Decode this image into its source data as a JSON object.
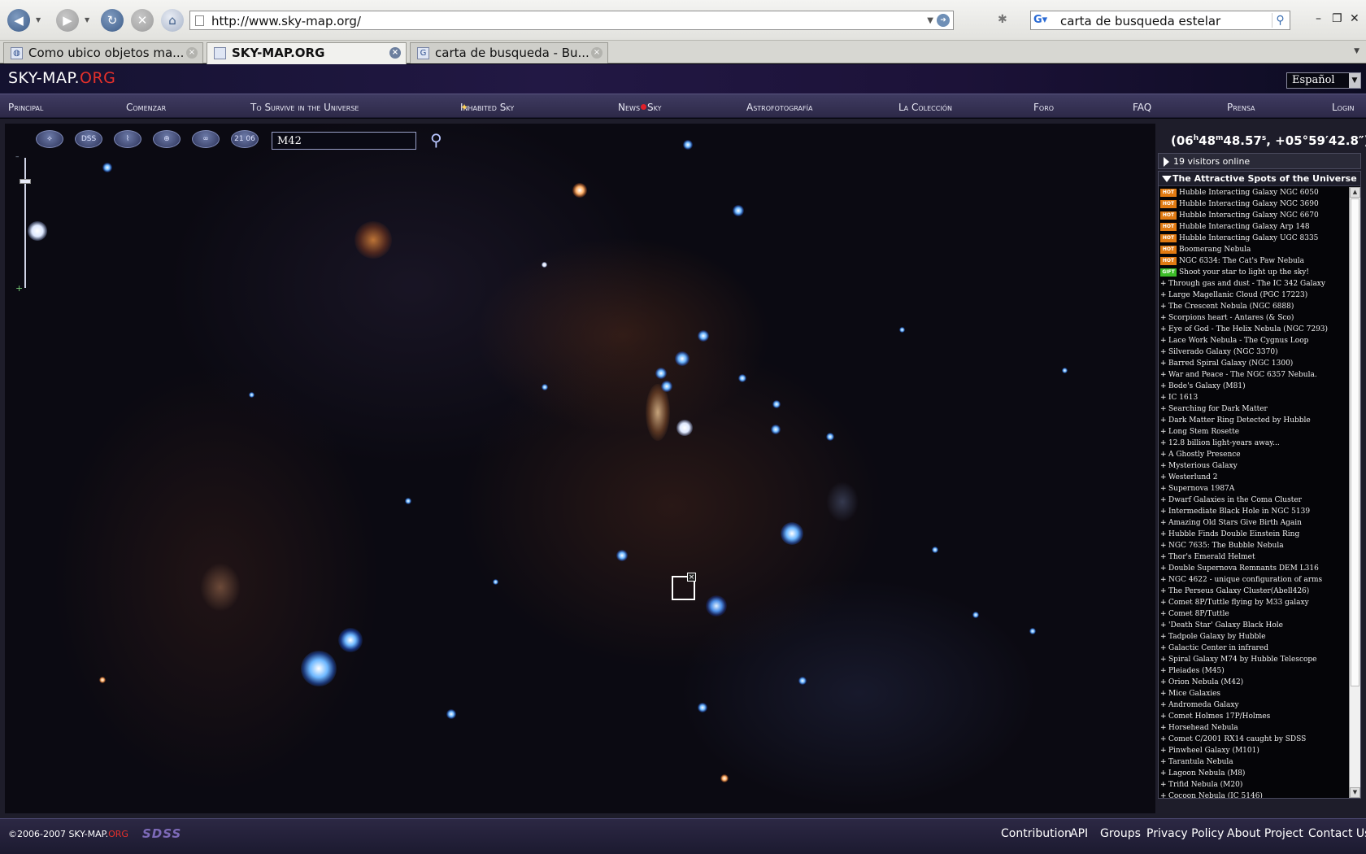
{
  "browser": {
    "url": "http://www.sky-map.org/",
    "search_query": "carta de busqueda estelar",
    "tabs": [
      {
        "title": "Como ubico objetos ma...",
        "active": false
      },
      {
        "title": "SKY-MAP.ORG",
        "active": true
      },
      {
        "title": "carta de busqueda - Bu...",
        "active": false
      }
    ]
  },
  "site": {
    "logo_main": "SKY-MAP.",
    "logo_org": "ORG",
    "language": "Español",
    "nav": [
      "Principal",
      "Comenzar",
      "To Survive in the Universe",
      "Inhabited Sky",
      "News",
      "Sky",
      "Astrofotografía",
      "La Colección",
      "Foro",
      "FAQ",
      "Prensa",
      "Login"
    ]
  },
  "sky": {
    "tools": [
      "",
      "DSS",
      "",
      "",
      "",
      "21 06"
    ],
    "search_value": "M42",
    "coords": {
      "ra_h": "(06",
      "h": "h",
      "ra_m": "48",
      "m": "m",
      "ra_s": "48.57",
      "s": "s",
      "dec": ", +05°59′42.8″)"
    },
    "close_mark": "×"
  },
  "panel": {
    "visitors": "19 visitors online",
    "spots_title": "The Attractive Spots of the Universe",
    "spots": [
      {
        "badge": "HOT",
        "name": "Hubble Interacting Galaxy NGC 6050"
      },
      {
        "badge": "HOT",
        "name": "Hubble Interacting Galaxy NGC 3690"
      },
      {
        "badge": "HOT",
        "name": "Hubble Interacting Galaxy NGC 6670"
      },
      {
        "badge": "HOT",
        "name": "Hubble Interacting Galaxy Arp 148"
      },
      {
        "badge": "HOT",
        "name": "Hubble Interacting Galaxy UGC 8335"
      },
      {
        "badge": "HOT",
        "name": "Boomerang Nebula"
      },
      {
        "badge": "HOT",
        "name": "NGC 6334: The Cat's Paw Nebula"
      },
      {
        "badge": "GIFT",
        "name": "Shoot your star to light up the sky!"
      },
      {
        "badge": "",
        "name": "Through gas and dust - The IC 342 Galaxy"
      },
      {
        "badge": "",
        "name": "Large Magellanic Cloud (PGC 17223)"
      },
      {
        "badge": "",
        "name": "The Crescent Nebula (NGC 6888)"
      },
      {
        "badge": "",
        "name": "Scorpions heart - Antares (& Sco)"
      },
      {
        "badge": "",
        "name": "Eye of God - The Helix Nebula (NGC 7293)"
      },
      {
        "badge": "",
        "name": "Lace Work Nebula - The Cygnus Loop"
      },
      {
        "badge": "",
        "name": "Silverado Galaxy (NGC 3370)"
      },
      {
        "badge": "",
        "name": "Barred Spiral Galaxy (NGC 1300)"
      },
      {
        "badge": "",
        "name": "War and Peace - The NGC 6357 Nebula."
      },
      {
        "badge": "",
        "name": "Bode's Galaxy (M81)"
      },
      {
        "badge": "",
        "name": "IC 1613"
      },
      {
        "badge": "",
        "name": "Searching for Dark Matter"
      },
      {
        "badge": "",
        "name": "Dark Matter Ring Detected by Hubble"
      },
      {
        "badge": "",
        "name": "Long Stem Rosette"
      },
      {
        "badge": "",
        "name": "12.8 billion light-years away..."
      },
      {
        "badge": "",
        "name": "A Ghostly Presence"
      },
      {
        "badge": "",
        "name": "Mysterious Galaxy"
      },
      {
        "badge": "",
        "name": "Westerlund 2"
      },
      {
        "badge": "",
        "name": "Supernova 1987A"
      },
      {
        "badge": "",
        "name": "Dwarf Galaxies in the Coma Cluster"
      },
      {
        "badge": "",
        "name": "Intermediate Black Hole in NGC 5139"
      },
      {
        "badge": "",
        "name": "Amazing Old Stars Give Birth Again"
      },
      {
        "badge": "",
        "name": "Hubble Finds Double Einstein Ring"
      },
      {
        "badge": "",
        "name": "NGC 7635: The Bubble Nebula"
      },
      {
        "badge": "",
        "name": "Thor's Emerald Helmet"
      },
      {
        "badge": "",
        "name": "Double Supernova Remnants DEM L316"
      },
      {
        "badge": "",
        "name": "NGC 4622 - unique configuration of arms"
      },
      {
        "badge": "",
        "name": "The Perseus Galaxy Cluster(Abell426)"
      },
      {
        "badge": "",
        "name": "Comet 8P/Tuttle flying by M33 galaxy"
      },
      {
        "badge": "",
        "name": "Comet 8P/Tuttle"
      },
      {
        "badge": "",
        "name": "'Death Star' Galaxy Black Hole"
      },
      {
        "badge": "",
        "name": "Tadpole Galaxy by Hubble"
      },
      {
        "badge": "",
        "name": "Galactic Center in infrared"
      },
      {
        "badge": "",
        "name": "Spiral Galaxy M74 by Hubble Telescope"
      },
      {
        "badge": "",
        "name": "Pleiades (M45)"
      },
      {
        "badge": "",
        "name": "Orion Nebula (M42)"
      },
      {
        "badge": "",
        "name": "Mice Galaxies"
      },
      {
        "badge": "",
        "name": "Andromeda Galaxy"
      },
      {
        "badge": "",
        "name": "Comet Holmes 17P/Holmes"
      },
      {
        "badge": "",
        "name": "Horsehead Nebula"
      },
      {
        "badge": "",
        "name": "Comet C/2001 RX14 caught by SDSS"
      },
      {
        "badge": "",
        "name": "Pinwheel Galaxy (M101)"
      },
      {
        "badge": "",
        "name": "Tarantula Nebula"
      },
      {
        "badge": "",
        "name": "Lagoon Nebula (M8)"
      },
      {
        "badge": "",
        "name": "Trifid Nebula (M20)"
      },
      {
        "badge": "",
        "name": "Cocoon Nebula (IC 5146)"
      }
    ]
  },
  "footer": {
    "copyright": "©2006-2007 SKY-MAP.",
    "copyright_org": "ORG",
    "sdss": "SDSS",
    "links": [
      "Contribution",
      "API",
      "Groups",
      "Privacy Policy",
      "About Project",
      "Contact Us"
    ]
  },
  "colors": {
    "brand_red": "#e5302b",
    "hot_badge": "#e07a12",
    "gift_badge": "#3cbd28",
    "nav_bg": "#3f3b61"
  }
}
